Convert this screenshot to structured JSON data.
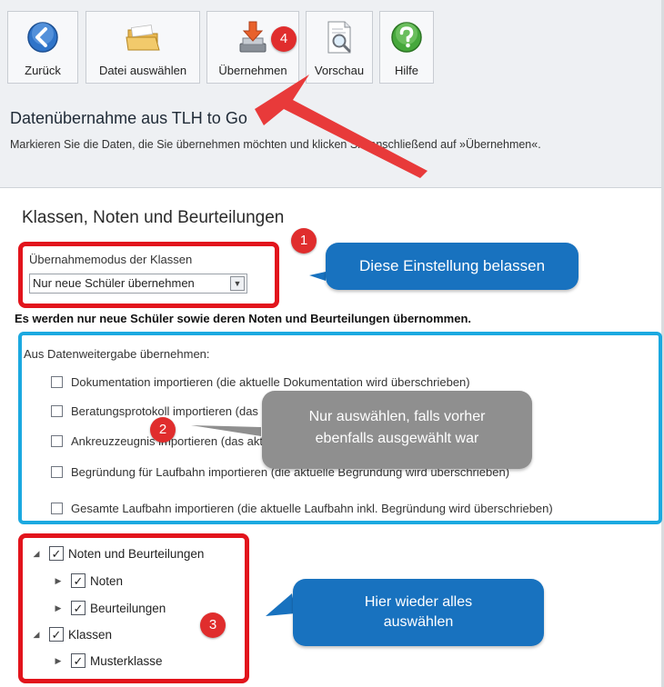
{
  "toolbar": {
    "back_label": "Zurück",
    "choose_file_label": "Datei auswählen",
    "import_label": "Übernehmen",
    "preview_label": "Vorschau",
    "help_label": "Hilfe"
  },
  "header": {
    "title": "Datenübernahme aus TLH to Go",
    "hint": "Markieren Sie die Daten, die Sie übernehmen möchten und klicken Sie anschließend auf »Übernehmen«."
  },
  "section": {
    "title": "Klassen, Noten und Beurteilungen",
    "mode_label": "Übernahmemodus der Klassen",
    "mode_value": "Nur neue Schüler übernehmen",
    "mode_note": "Es werden nur neue Schüler sowie deren Noten und Beurteilungen übernommen.",
    "transfer_label": "Aus Datenweitergabe übernehmen:",
    "options": [
      {
        "label": "Dokumentation importieren (die aktuelle Dokumentation wird überschrieben)",
        "checked": false
      },
      {
        "label": "Beratungsprotokoll importieren (das aktuelle Beratungsprotokoll wird überschrieben)",
        "checked": false
      },
      {
        "label": "Ankreuzzeugnis importieren (das aktuelle Ankreuzzeugnis wird überschrieben)",
        "checked": false
      },
      {
        "label": "Begründung für Laufbahn importieren (die aktuelle Begründung wird überschrieben)",
        "checked": false
      },
      {
        "label": "Gesamte Laufbahn importieren (die aktuelle Laufbahn inkl. Begründung wird überschrieben)",
        "checked": false
      }
    ]
  },
  "tree": [
    {
      "label": "Noten und Beurteilungen",
      "checked": true,
      "expanded": true
    },
    {
      "label": "Noten",
      "checked": true,
      "expanded": false
    },
    {
      "label": "Beurteilungen",
      "checked": true,
      "expanded": false
    },
    {
      "label": "Klassen",
      "checked": true,
      "expanded": true
    },
    {
      "label": "Musterklasse",
      "checked": true,
      "expanded": false
    }
  ],
  "annotations": {
    "badge_1": "1",
    "badge_2": "2",
    "badge_3": "3",
    "badge_4": "4",
    "bubble_1": "Diese Einstellung belassen",
    "bubble_2_line1": "Nur auswählen, falls vorher",
    "bubble_2_line2": "ebenfalls ausgewählt war",
    "bubble_3_line1": "Hier wieder alles",
    "bubble_3_line2": "auswählen"
  },
  "colors": {
    "highlight_red": "#e2141c",
    "highlight_blue": "#1ba9e0",
    "bubble_blue": "#1872bf",
    "bubble_grey": "#8f8f8f",
    "badge_red": "#e02d2d"
  },
  "icons": {
    "back": "back-arrow-icon",
    "choose_file": "folder-icon",
    "import": "import-download-icon",
    "preview": "preview-magnifier-icon",
    "help": "help-question-icon"
  }
}
